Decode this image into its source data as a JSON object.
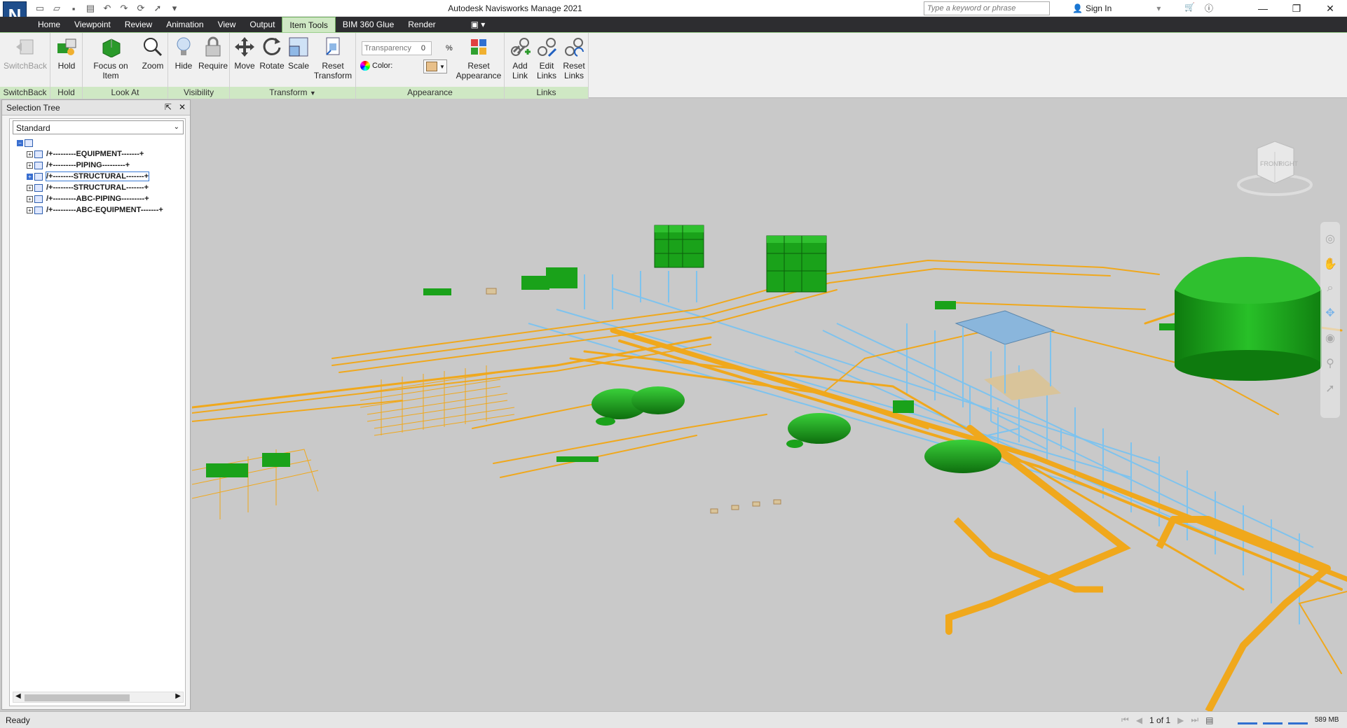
{
  "app": {
    "logo_letter": "N",
    "title": "Autodesk Navisworks Manage 2021",
    "search_placeholder": "Type a keyword or phrase",
    "sign_in": "Sign In"
  },
  "menu_tabs": [
    "Home",
    "Viewpoint",
    "Review",
    "Animation",
    "View",
    "Output",
    "Item Tools",
    "BIM 360 Glue",
    "Render"
  ],
  "active_tab": "Item Tools",
  "ribbon": {
    "panels": {
      "switchback": "SwitchBack",
      "hold": "Hold",
      "look_at": "Look At",
      "visibility": "Visibility",
      "transform": "Transform",
      "appearance": "Appearance",
      "links": "Links"
    },
    "buttons": {
      "switchback": "SwitchBack",
      "hold": "Hold",
      "focus": "Focus on Item",
      "zoom": "Zoom",
      "hide": "Hide",
      "require": "Require",
      "move": "Move",
      "rotate": "Rotate",
      "scale": "Scale",
      "reset_transform_1": "Reset",
      "reset_transform_2": "Transform",
      "reset_appearance_1": "Reset",
      "reset_appearance_2": "Appearance",
      "add_link_1": "Add",
      "add_link_2": "Link",
      "edit_links_1": "Edit",
      "edit_links_2": "Links",
      "reset_links_1": "Reset",
      "reset_links_2": "Links"
    },
    "transparency_label": "Transparency",
    "transparency_value": "0",
    "transparency_unit": "%",
    "color_label": "Color:",
    "color_swatch": "#e8c08a"
  },
  "selection_tree": {
    "title": "Selection Tree",
    "mode": "Standard",
    "items": [
      "/+---------EQUIPMENT-------+",
      "/+---------PIPING---------+",
      "/+--------STRUCTURAL-------+",
      "/+--------STRUCTURAL-------+",
      "/+---------ABC-PIPING---------+",
      "/+---------ABC-EQUIPMENT-------+"
    ],
    "selected_index": 2
  },
  "viewcube": {
    "front": "FRONT",
    "right": "RIGHT"
  },
  "status": {
    "text": "Ready",
    "page": "1 of 1",
    "memory": "589 MB"
  },
  "colors": {
    "pipe": "#f0a81c",
    "equipment": "#1aa21a",
    "steel": "#7ec3ee",
    "ribbon_accent": "#cfe8c4"
  }
}
